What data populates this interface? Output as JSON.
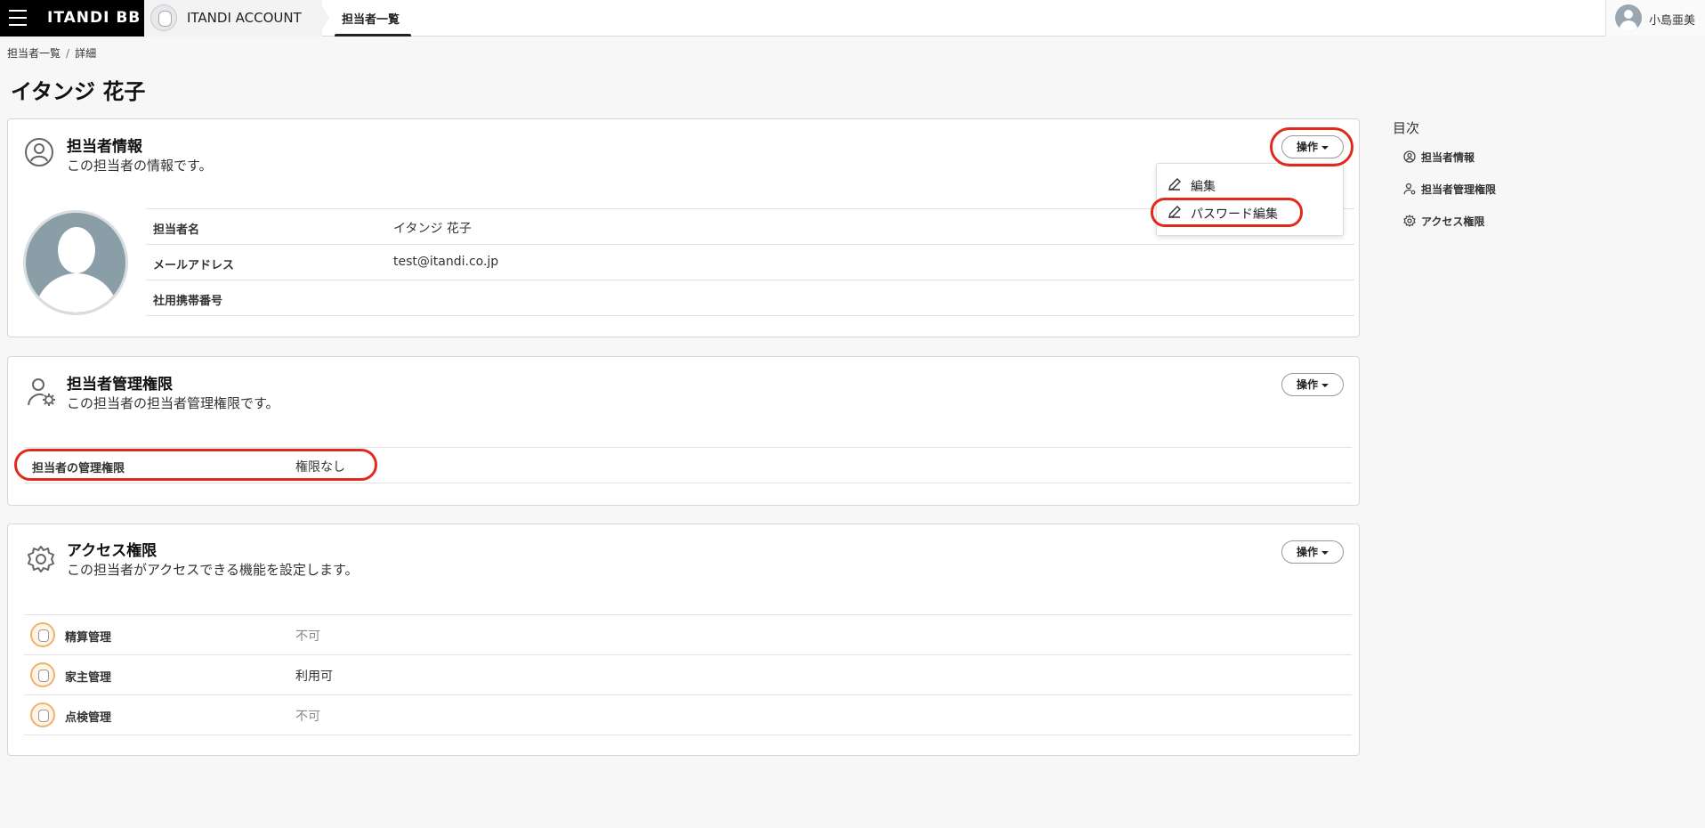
{
  "header": {
    "brand": "ITANDI BB",
    "account": "ITANDI ACCOUNT",
    "active_tab": "担当者一覧",
    "user_name": "小島亜美"
  },
  "breadcrumb": {
    "parent": "担当者一覧",
    "separator": "/",
    "current": "詳細"
  },
  "page_title": "イタンジ 花子",
  "cards": {
    "info": {
      "title": "担当者情報",
      "description": "この担当者の情報です。",
      "operation_label": "操作",
      "rows": [
        {
          "label": "担当者名",
          "value": "イタンジ 花子"
        },
        {
          "label": "メールアドレス",
          "value": "test@itandi.co.jp"
        },
        {
          "label": "社用携帯番号",
          "value": ""
        }
      ],
      "dropdown": {
        "edit": "編集",
        "password_edit": "パスワード編集"
      }
    },
    "admin": {
      "title": "担当者管理権限",
      "description": "この担当者の担当者管理権限です。",
      "operation_label": "操作",
      "row": {
        "label": "担当者の管理権限",
        "value": "権限なし"
      }
    },
    "access": {
      "title": "アクセス権限",
      "description": "この担当者がアクセスできる機能を設定します。",
      "operation_label": "操作",
      "rows": [
        {
          "label": "精算管理",
          "value": "不可",
          "icon": "settlement-service-icon"
        },
        {
          "label": "家主管理",
          "value": "利用可",
          "icon": "landlord-service-icon"
        },
        {
          "label": "点検管理",
          "value": "不可",
          "icon": "inspection-service-icon"
        }
      ]
    }
  },
  "toc": {
    "title": "目次",
    "items": [
      "担当者情報",
      "担当者管理権限",
      "アクセス権限"
    ]
  },
  "colors": {
    "highlight": "#e02a1c",
    "brand_bg": "#000000"
  }
}
